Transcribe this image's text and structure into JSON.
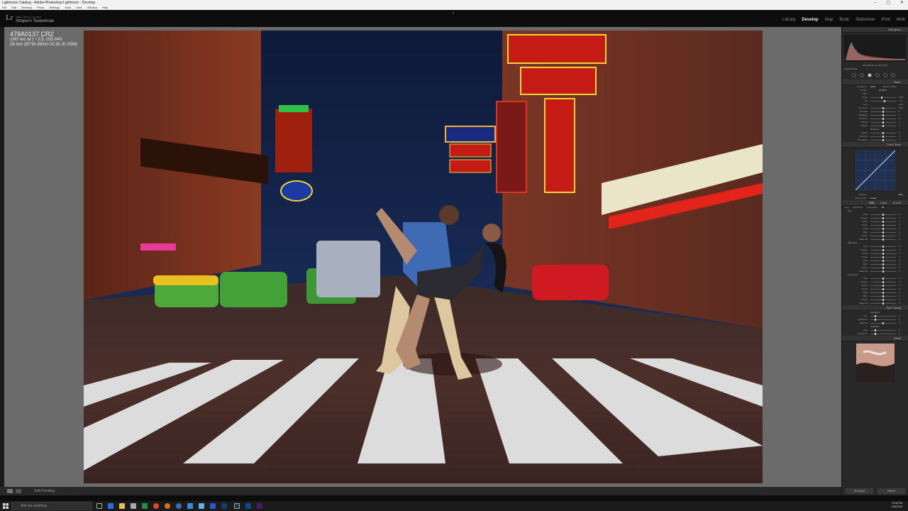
{
  "window": {
    "title": "Lightroom Catalog - Adobe Photoshop Lightroom - Develop",
    "controls": [
      "–",
      "▢",
      "✕"
    ],
    "menu": [
      "File",
      "Edit",
      "Develop",
      "Photo",
      "Settings",
      "Tools",
      "View",
      "Window",
      "Help"
    ]
  },
  "header": {
    "logo": "Lr",
    "app_name": "Adobe Lightroom CC 2015",
    "user": "Attaporn Taweekraw",
    "modules": [
      "Library",
      "Develop",
      "Map",
      "Book",
      "Slideshow",
      "Print",
      "Web"
    ],
    "active_module": "Develop"
  },
  "photo_info": {
    "filename": "478A0137.CR2",
    "exposure": "1/60 sec at ƒ / 3.5, ISO 640",
    "lens": "26 mm (EF16-35mm f/2.8L III USM)"
  },
  "right_panel": {
    "histogram_label": "Histogram",
    "histogram_info": "ISO 640  26 mm  f/3.5  1/60",
    "original_photo": "Original Photo",
    "basic_label": "Basic",
    "treatment_label": "Treatment :",
    "treatment_options": [
      "Color",
      "Black & White"
    ],
    "profile_label": "Profile :",
    "profile_value": "As Shot",
    "wb_label": "WB :",
    "wb_rows": [
      {
        "label": "Temp",
        "value": "4000",
        "pos": 0.45
      },
      {
        "label": "Tint",
        "value": "+ 11",
        "pos": 0.55
      }
    ],
    "tone_label": "Tone",
    "tone_auto": "Auto",
    "tone_rows": [
      {
        "label": "Exposure",
        "value": "0.00",
        "pos": 0.5
      },
      {
        "label": "Contrast",
        "value": "0",
        "pos": 0.5
      },
      {
        "label": "Highlights",
        "value": "0",
        "pos": 0.5
      },
      {
        "label": "Shadows",
        "value": "0",
        "pos": 0.5
      },
      {
        "label": "Whites",
        "value": "0",
        "pos": 0.5
      },
      {
        "label": "Blacks",
        "value": "0",
        "pos": 0.5
      }
    ],
    "presence_label": "Presence",
    "presence_rows": [
      {
        "label": "Clarity",
        "value": "0",
        "pos": 0.5
      },
      {
        "label": "Vibrance",
        "value": "0",
        "pos": 0.5
      },
      {
        "label": "Saturation",
        "value": "0",
        "pos": 0.5
      }
    ],
    "tone_curve_label": "Tone Curve",
    "curve_channel": "Channel :",
    "curve_channel_value": "Blue",
    "point_curve_label": "Point Curve :",
    "point_curve_value": "Linear",
    "hsl_tabs": [
      "HSL",
      "Color",
      "B & W"
    ],
    "hsl_subtabs": [
      "Hue",
      "Saturation",
      "Luminance",
      "All"
    ],
    "hsl_sections": [
      {
        "name": "Hue",
        "rows": [
          {
            "label": "Red",
            "value": "0",
            "pos": 0.5
          },
          {
            "label": "Orange",
            "value": "0",
            "pos": 0.5
          },
          {
            "label": "Yellow",
            "value": "0",
            "pos": 0.5
          },
          {
            "label": "Green",
            "value": "0",
            "pos": 0.5
          },
          {
            "label": "Aqua",
            "value": "0",
            "pos": 0.5
          },
          {
            "label": "Blue",
            "value": "0",
            "pos": 0.5
          },
          {
            "label": "Purple",
            "value": "0",
            "pos": 0.5
          },
          {
            "label": "Magenta",
            "value": "0",
            "pos": 0.5
          }
        ]
      },
      {
        "name": "Saturation",
        "rows": [
          {
            "label": "Red",
            "value": "0",
            "pos": 0.5
          },
          {
            "label": "Orange",
            "value": "0",
            "pos": 0.5
          },
          {
            "label": "Yellow",
            "value": "0",
            "pos": 0.5
          },
          {
            "label": "Green",
            "value": "0",
            "pos": 0.5
          },
          {
            "label": "Aqua",
            "value": "0",
            "pos": 0.5
          },
          {
            "label": "Blue",
            "value": "0",
            "pos": 0.5
          },
          {
            "label": "Purple",
            "value": "0",
            "pos": 0.5
          },
          {
            "label": "Magenta",
            "value": "0",
            "pos": 0.5
          }
        ]
      },
      {
        "name": "Luminance",
        "rows": [
          {
            "label": "Red",
            "value": "0",
            "pos": 0.5
          },
          {
            "label": "Orange",
            "value": "0",
            "pos": 0.5
          },
          {
            "label": "Yellow",
            "value": "0",
            "pos": 0.5
          },
          {
            "label": "Green",
            "value": "0",
            "pos": 0.5
          },
          {
            "label": "Aqua",
            "value": "0",
            "pos": 0.5
          },
          {
            "label": "Blue",
            "value": "0",
            "pos": 0.5
          },
          {
            "label": "Purple",
            "value": "0",
            "pos": 0.5
          },
          {
            "label": "Magenta",
            "value": "0",
            "pos": 0.5
          }
        ]
      }
    ],
    "split_toning_label": "Split Toning",
    "split_highlights": "Highlights",
    "split_shadows": "Shadows",
    "split_balance": "Balance",
    "split_rows": [
      {
        "label": "Hue",
        "value": "0",
        "pos": 0.2
      },
      {
        "label": "Saturation",
        "value": "0",
        "pos": 0.2
      }
    ],
    "balance_row": {
      "label": "Balance",
      "value": "0",
      "pos": 0.5
    },
    "detail_label": "Detail",
    "previous_btn": "Previous",
    "reset_btn": "Reset"
  },
  "bottom": {
    "soft_proofing": "Soft Proofing"
  },
  "taskbar": {
    "search_placeholder": "Ask me anything",
    "time": "10:08 PM",
    "date": "1/26/2016"
  }
}
